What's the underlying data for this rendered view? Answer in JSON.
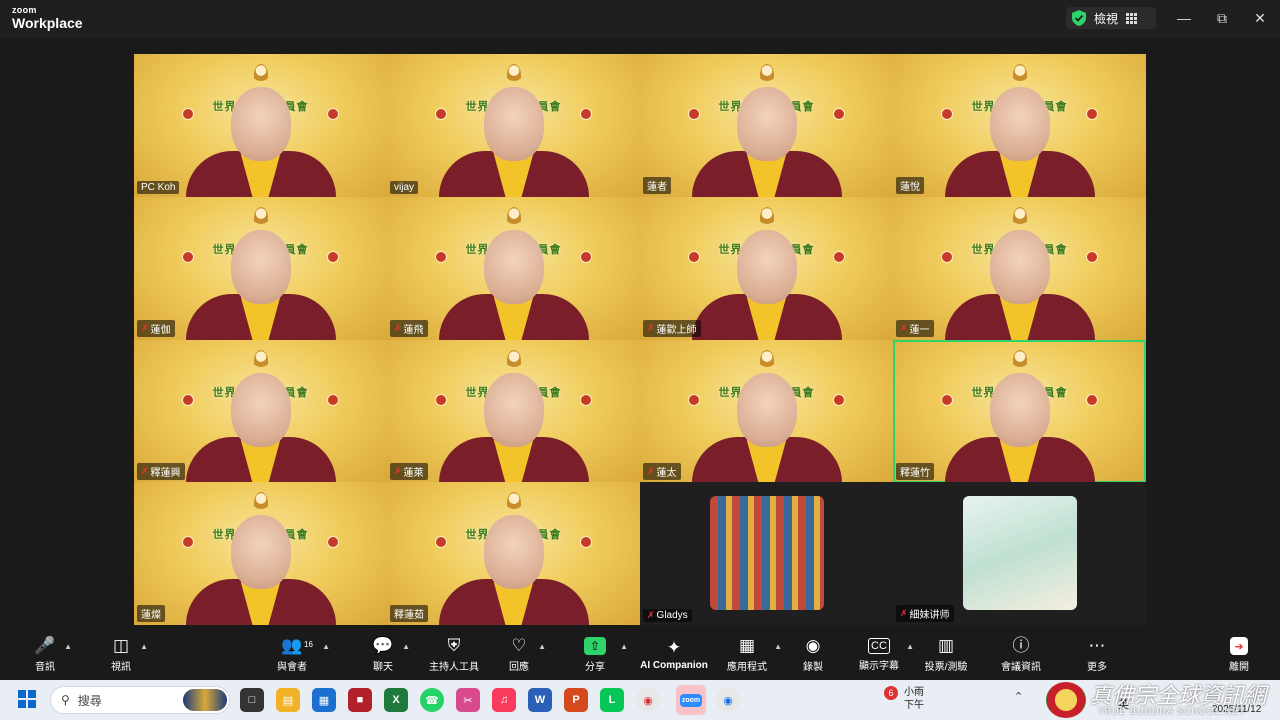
{
  "app": {
    "brand_small": "zoom",
    "brand_large": "Workplace"
  },
  "header": {
    "view_label": "檢視"
  },
  "participants": [
    {
      "name": "PC Koh",
      "muted": false
    },
    {
      "name": "vijay",
      "muted": false
    },
    {
      "name": "蓮者",
      "muted": false
    },
    {
      "name": "蓮悅",
      "muted": false
    },
    {
      "name": "蓮伽",
      "muted": true
    },
    {
      "name": "蓮飛",
      "muted": true
    },
    {
      "name": "蓮歡上師",
      "muted": true
    },
    {
      "name": "蓮一",
      "muted": true
    },
    {
      "name": "釋蓮興",
      "muted": true
    },
    {
      "name": "蓮萊",
      "muted": true
    },
    {
      "name": "蓮太",
      "muted": true
    },
    {
      "name": "釋蓮竹",
      "muted": false
    },
    {
      "name": "蓮燦",
      "muted": false
    },
    {
      "name": "釋蓮茹",
      "muted": false
    },
    {
      "name": "Gladys",
      "muted": true
    },
    {
      "name": "細妹讲师",
      "muted": true
    }
  ],
  "banner_text": "世界真佛宗委員會",
  "toolbar": {
    "audio": "音訊",
    "video": "視訊",
    "participants": "與會者",
    "participants_count": "16",
    "chat": "聊天",
    "host_tools": "主持人工具",
    "reactions": "回應",
    "share": "分享",
    "ai_companion": "AI Companion",
    "apps": "應用程式",
    "record": "錄製",
    "captions": "顯示字幕",
    "polls": "投票/測驗",
    "meeting_info": "會議資訊",
    "more": "更多",
    "leave": "離開"
  },
  "taskbar": {
    "search_placeholder": "搜尋",
    "weather_badge": "6",
    "weather_text": "小雨",
    "time_period": "下午",
    "ime": "英",
    "date": "2025/11/12"
  },
  "watermark": {
    "title": "真佛宗全球資訊網",
    "subtitle": "TRUE BUDDHA SCHOOL.NET"
  },
  "colors": {
    "active_speaker": "#2fd36b",
    "tile_gold": "#f0cc5c",
    "robe": "#7a1f2a"
  }
}
